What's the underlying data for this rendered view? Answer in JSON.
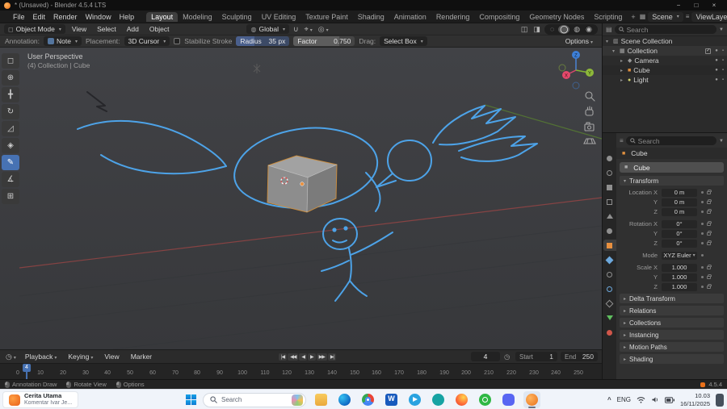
{
  "window": {
    "title": "* (Unsaved) - Blender 4.5.4 LTS",
    "controls": {
      "minimize": "−",
      "maximize": "□",
      "close": "×"
    }
  },
  "menu_bar": {
    "menus": [
      "File",
      "Edit",
      "Render",
      "Window",
      "Help"
    ],
    "workspaces": [
      "Layout",
      "Modeling",
      "Sculpting",
      "UV Editing",
      "Texture Paint",
      "Shading",
      "Animation",
      "Rendering",
      "Compositing",
      "Geometry Nodes",
      "Scripting"
    ],
    "add_tab": "+",
    "scene_label": "Scene",
    "view_layer_label": "ViewLayer"
  },
  "tool_header": {
    "mode_label": "Object Mode",
    "menus": [
      "View",
      "Select",
      "Add",
      "Object"
    ],
    "orientation": "Global"
  },
  "tool_settings": {
    "annotation_label": "Annotation:",
    "layer": "Note",
    "placement_label": "Placement:",
    "placement": "3D Cursor",
    "stabilize_label": "Stabilize Stroke",
    "radius_label": "Radius",
    "radius_value": "35 px",
    "factor_label": "Factor",
    "factor_value": "0.750",
    "drag_label": "Drag:",
    "drag_value": "Select Box",
    "options_label": "Options"
  },
  "viewport": {
    "view_label": "User Perspective",
    "collection_label": "(4) Collection | Cube",
    "gizmo": {
      "x": "X",
      "y": "Y",
      "z": "Z"
    }
  },
  "outliner": {
    "search_placeholder": "Search",
    "scene_collection": "Scene Collection",
    "collection": "Collection",
    "objects": [
      {
        "name": "Camera"
      },
      {
        "name": "Cube"
      },
      {
        "name": "Light"
      }
    ]
  },
  "properties": {
    "search_placeholder": "Search",
    "breadcrumb": "Cube",
    "name_field": "Cube",
    "transform_title": "Transform",
    "rows": [
      {
        "label": "Location X",
        "value": "0 m"
      },
      {
        "label": "Y",
        "value": "0 m"
      },
      {
        "label": "Z",
        "value": "0 m"
      },
      {
        "label": "Rotation X",
        "value": "0°"
      },
      {
        "label": "Y",
        "value": "0°"
      },
      {
        "label": "Z",
        "value": "0°"
      },
      {
        "label": "Mode",
        "value": "XYZ Euler"
      },
      {
        "label": "Scale X",
        "value": "1.000"
      },
      {
        "label": "Y",
        "value": "1.000"
      },
      {
        "label": "Z",
        "value": "1.000"
      }
    ],
    "panels": [
      "Delta Transform",
      "Relations",
      "Collections",
      "Instancing",
      "Motion Paths",
      "Shading"
    ]
  },
  "timeline": {
    "menus": [
      "Playback",
      "Keying",
      "View",
      "Marker"
    ],
    "current_frame": "4",
    "start_label": "Start",
    "start_value": "1",
    "end_label": "End",
    "end_value": "250",
    "ticks": [
      "0",
      "10",
      "20",
      "30",
      "40",
      "50",
      "60",
      "70",
      "80",
      "90",
      "100",
      "110",
      "120",
      "130",
      "140",
      "150",
      "160",
      "170",
      "180",
      "190",
      "200",
      "210",
      "220",
      "230",
      "240",
      "250"
    ]
  },
  "status_bar": {
    "hints": [
      "Annotation Draw",
      "Rotate View",
      "Options"
    ],
    "version": "4.5.4"
  },
  "taskbar": {
    "notification": {
      "title": "Cerita Utama",
      "body": "Komentar Ivar Je..."
    },
    "search_placeholder": "Search",
    "language": "ENG",
    "time": "10.03",
    "date": "16/11/2025"
  },
  "icons": {
    "select_box": "◻",
    "cursor": "⊕",
    "move": "╋",
    "rotate": "↻",
    "scale": "◿",
    "transform": "◈",
    "annotate": "✎",
    "measure": "∡",
    "add_cube": "⊞",
    "globe": "◍",
    "magnet": "∪",
    "snapping": "⌖",
    "falloff": "◎",
    "overlay_a": "◫",
    "overlay_b": "◨",
    "wireframe": "◌",
    "solid": "◯",
    "material_preview": "◍",
    "rendered": "◉",
    "editor_clock": "◷",
    "outliner_editor": "▤",
    "properties_editor": "≡",
    "filter": "▼",
    "scene_glyph": "▦",
    "viewlayer_glyph": "≡",
    "camera_object": "◆",
    "cube_object": "■",
    "light_object": "●",
    "eye": "●",
    "render_toggle": "▪",
    "collection_glyph": "▦",
    "scene_collection_glyph": "▥",
    "transport": [
      "|◀",
      "◀◀",
      "◀",
      "▶",
      "▶▶",
      "▶|"
    ]
  },
  "colors": {
    "accent": "#4772b3",
    "annotation": "#4da3e8",
    "selection": "#e8903f"
  }
}
